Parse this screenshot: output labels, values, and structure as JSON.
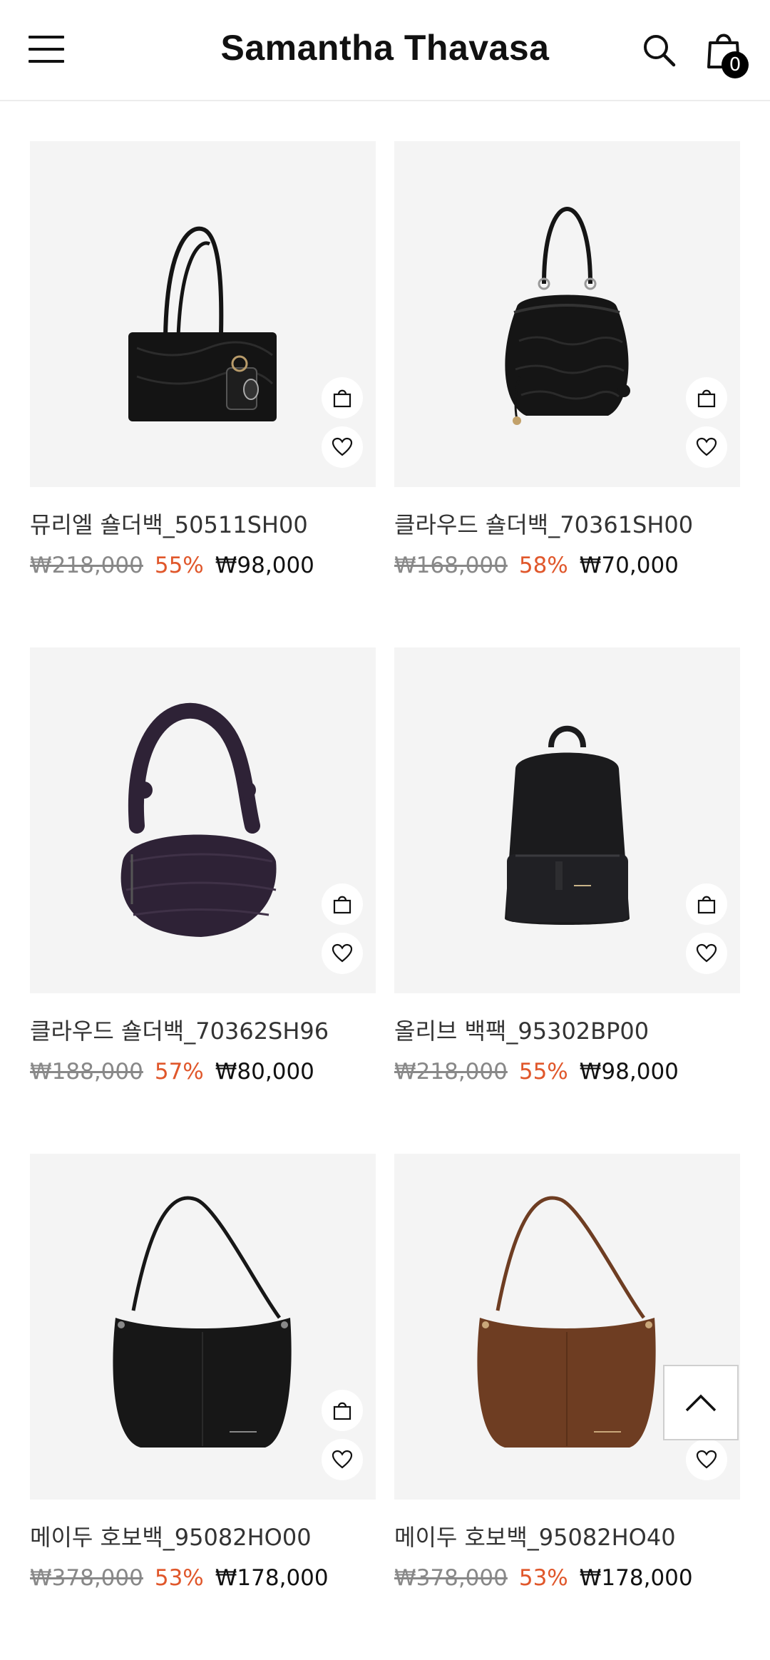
{
  "header": {
    "logo": "Samantha Thavasa",
    "cart_count": "0"
  },
  "products": [
    {
      "name": "뮤리엘 숄더백_50511SH00",
      "original_price": "₩218,000",
      "discount": "55%",
      "sale_price": "₩98,000",
      "color": "#141414"
    },
    {
      "name": "클라우드 숄더백_70361SH00",
      "original_price": "₩168,000",
      "discount": "58%",
      "sale_price": "₩70,000",
      "color": "#151515"
    },
    {
      "name": "클라우드 숄더백_70362SH96",
      "original_price": "₩188,000",
      "discount": "57%",
      "sale_price": "₩80,000",
      "color": "#2e2236"
    },
    {
      "name": "올리브 백팩_95302BP00",
      "original_price": "₩218,000",
      "discount": "55%",
      "sale_price": "₩98,000",
      "color": "#1b1b1d"
    },
    {
      "name": "메이두 호보백_95082HO00",
      "original_price": "₩378,000",
      "discount": "53%",
      "sale_price": "₩178,000",
      "color": "#171717"
    },
    {
      "name": "메이두 호보백_95082HO40",
      "original_price": "₩378,000",
      "discount": "53%",
      "sale_price": "₩178,000",
      "color": "#6e3d22"
    }
  ],
  "icons": {
    "menu": "hamburger-icon",
    "search": "search-icon",
    "cart": "shopping-bag-icon",
    "add_to_cart": "shopping-bag-icon",
    "wishlist": "heart-icon",
    "scroll_top": "chevron-up-icon"
  },
  "colors": {
    "discount": "#e0572b",
    "thumb_bg": "#f4f4f4"
  }
}
